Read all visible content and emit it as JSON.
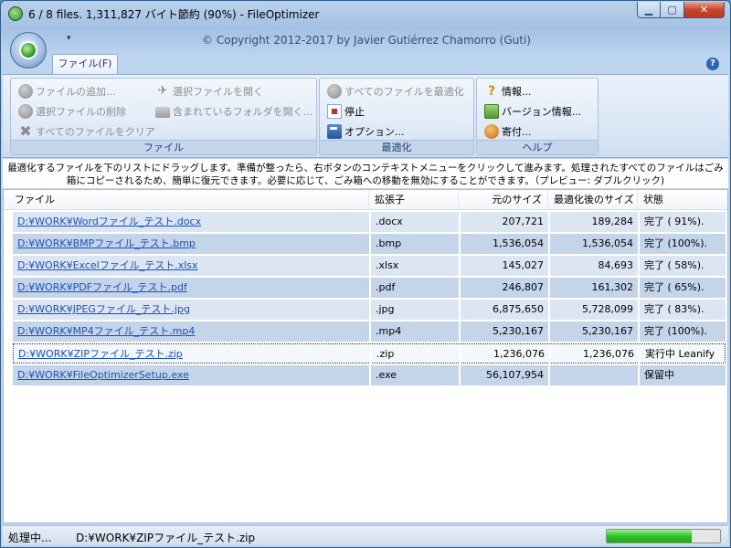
{
  "window": {
    "title": "6 / 8 files. 1,311,827 バイト節約 (90%) - FileOptimizer",
    "controls": {
      "minimize": "▁",
      "maximize": "▢",
      "close": "✕"
    }
  },
  "ribbon": {
    "copyright": "© Copyright 2012-2017 by Javier Gutiérrez Chamorro (Guti)",
    "qat_arrow": "▾",
    "tab_file": "ファイル(F)",
    "help": "?",
    "groups": {
      "file": {
        "label": "ファイル",
        "add_files": "ファイルの追加...",
        "remove_selected": "選択ファイルの削除",
        "clear_all": "すべてのファイルをクリア",
        "open_selected": "選択ファイルを開く",
        "open_folder": "含まれているフォルダを開く..."
      },
      "optimize": {
        "label": "最適化",
        "optimize_all": "すべてのファイルを最適化",
        "stop": "停止",
        "options": "オプション..."
      },
      "help": {
        "label": "ヘルプ",
        "info": "情報...",
        "version": "バージョン情報...",
        "donate": "寄付..."
      }
    }
  },
  "description": "最適化するファイルを下のリストにドラッグします。準備が整ったら、右ボタンのコンテキストメニューをクリックして進みます。処理されたすべてのファイルはごみ箱にコピーされるため、簡単に復元できます。必要に応じて、ごみ箱への移動を無効にすることができます。（プレビュー: ダブルクリック)",
  "table": {
    "headers": [
      "ファイル",
      "拡張子",
      "元のサイズ",
      "最適化後のサイズ",
      "状態"
    ],
    "rows": [
      {
        "file": "D:¥WORK¥Wordファイル_テスト.docx",
        "ext": ".docx",
        "orig": "207,721",
        "opt": "189,284",
        "status": "完了 ( 91%)."
      },
      {
        "file": "D:¥WORK¥BMPファイル_テスト.bmp",
        "ext": ".bmp",
        "orig": "1,536,054",
        "opt": "1,536,054",
        "status": "完了 (100%)."
      },
      {
        "file": "D:¥WORK¥Excelファイル_テスト.xlsx",
        "ext": ".xlsx",
        "orig": "145,027",
        "opt": "84,693",
        "status": "完了 ( 58%)."
      },
      {
        "file": "D:¥WORK¥PDFファイル_テスト.pdf",
        "ext": ".pdf",
        "orig": "246,807",
        "opt": "161,302",
        "status": "完了 ( 65%)."
      },
      {
        "file": "D:¥WORK¥JPEGファイル_テスト.jpg",
        "ext": ".jpg",
        "orig": "6,875,650",
        "opt": "5,728,099",
        "status": "完了 ( 83%)."
      },
      {
        "file": "D:¥WORK¥MP4ファイル_テスト.mp4",
        "ext": ".mp4",
        "orig": "5,230,167",
        "opt": "5,230,167",
        "status": "完了 (100%)."
      },
      {
        "file": "D:¥WORK¥ZIPファイル_テスト.zip",
        "ext": ".zip",
        "orig": "1,236,076",
        "opt": "1,236,076",
        "status": "実行中 Leanify"
      },
      {
        "file": "D:¥WORK¥FileOptimizerSetup.exe",
        "ext": ".exe",
        "orig": "56,107,954",
        "opt": "",
        "status": "保留中"
      }
    ]
  },
  "statusbar": {
    "state": "処理中...",
    "file": "D:¥WORK¥ZIPファイル_テスト.zip",
    "progress": 0.75
  }
}
